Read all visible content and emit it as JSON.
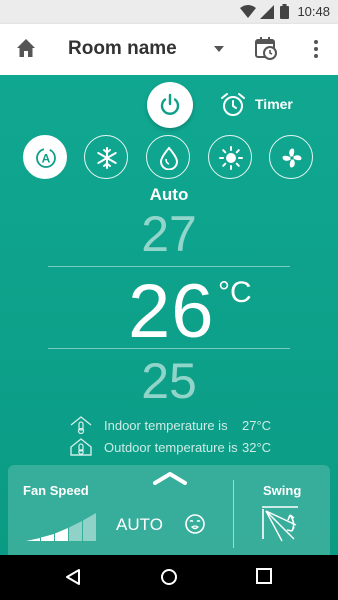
{
  "status_bar": {
    "time": "10:48"
  },
  "app_bar": {
    "title": "Room name"
  },
  "controls": {
    "timer_label": "Timer"
  },
  "modes": {
    "items": [
      "auto-mode",
      "cool-mode",
      "dry-mode",
      "heat-mode",
      "fan-mode"
    ],
    "selected": "auto-mode",
    "selected_label": "Auto"
  },
  "temperature": {
    "above": "27",
    "current": "26",
    "unit": "°C",
    "below": "25"
  },
  "info": {
    "indoor_label": "Indoor temperature is",
    "indoor_value": "27°C",
    "outdoor_label": "Outdoor temperature is",
    "outdoor_value": "32°C"
  },
  "bottom_panel": {
    "fan_speed_label": "Fan Speed",
    "fan_speed_value": "AUTO",
    "fan_speed_level": "auto",
    "swing_label": "Swing"
  },
  "colors": {
    "accent": "#0d9f88",
    "appbar": "#ffffff",
    "statusbar": "#ececec"
  }
}
